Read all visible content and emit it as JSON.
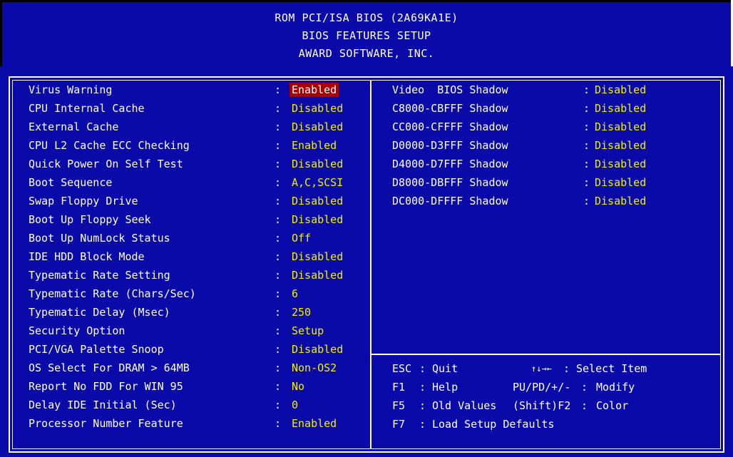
{
  "header": {
    "line1": "ROM PCI/ISA BIOS (2A69KA1E)",
    "line2": "BIOS FEATURES SETUP",
    "line3": "AWARD SOFTWARE, INC."
  },
  "colors": {
    "background": "#0a0aa8",
    "value": "#f0f000",
    "selected_bg": "#a80000",
    "text": "#ffffff"
  },
  "left_settings": [
    {
      "label": "Virus Warning",
      "colon": ":",
      "value": "Enabled",
      "selected": true
    },
    {
      "label": "CPU Internal Cache",
      "colon": ":",
      "value": "Disabled"
    },
    {
      "label": "External Cache",
      "colon": ":",
      "value": "Disabled"
    },
    {
      "label": "CPU L2 Cache ECC Checking",
      "colon": ":",
      "value": "Enabled"
    },
    {
      "label": "Quick Power On Self Test",
      "colon": ":",
      "value": "Disabled"
    },
    {
      "label": "Boot Sequence",
      "colon": ":",
      "value": "A,C,SCSI"
    },
    {
      "label": "Swap Floppy Drive",
      "colon": ":",
      "value": "Disabled"
    },
    {
      "label": "Boot Up Floppy Seek",
      "colon": ":",
      "value": "Disabled"
    },
    {
      "label": "Boot Up NumLock Status",
      "colon": ":",
      "value": "Off"
    },
    {
      "label": "IDE HDD Block Mode",
      "colon": ":",
      "value": "Disabled"
    },
    {
      "label": "Typematic Rate Setting",
      "colon": ":",
      "value": "Disabled"
    },
    {
      "label": "Typematic Rate (Chars/Sec)",
      "colon": ":",
      "value": "6"
    },
    {
      "label": "Typematic Delay (Msec)",
      "colon": ":",
      "value": "250"
    },
    {
      "label": "Security Option",
      "colon": ":",
      "value": "Setup"
    },
    {
      "label": "PCI/VGA Palette Snoop",
      "colon": ":",
      "value": "Disabled"
    },
    {
      "label": "OS Select For DRAM > 64MB",
      "colon": ":",
      "value": "Non-OS2"
    },
    {
      "label": "Report No FDD For WIN 95",
      "colon": ":",
      "value": "No"
    },
    {
      "label": "Delay IDE Initial (Sec)",
      "colon": ":",
      "value": "0"
    },
    {
      "label": "Processor Number Feature",
      "colon": ":",
      "value": "Enabled"
    }
  ],
  "right_settings": [
    {
      "label": "Video  BIOS Shadow",
      "colon": ":",
      "value": "Disabled"
    },
    {
      "label": "C8000-CBFFF Shadow",
      "colon": ":",
      "value": "Disabled"
    },
    {
      "label": "CC000-CFFFF Shadow",
      "colon": ":",
      "value": "Disabled"
    },
    {
      "label": "D0000-D3FFF Shadow",
      "colon": ":",
      "value": "Disabled"
    },
    {
      "label": "D4000-D7FFF Shadow",
      "colon": ":",
      "value": "Disabled"
    },
    {
      "label": "D8000-DBFFF Shadow",
      "colon": ":",
      "value": "Disabled"
    },
    {
      "label": "DC000-DFFFF Shadow",
      "colon": ":",
      "value": "Disabled"
    }
  ],
  "help": [
    {
      "key": "ESC",
      "sep": ":",
      "desc": "Quit",
      "key2": "↑↓→←",
      "sep2": ":",
      "desc2": "Select Item"
    },
    {
      "key": "F1",
      "sep": ":",
      "desc": "Help",
      "key2": "PU/PD/+/-",
      "sep2": ":",
      "desc2": "Modify"
    },
    {
      "key": "F5",
      "sep": ":",
      "desc": "Old Values",
      "key2": "(Shift)F2",
      "sep2": ":",
      "desc2": "Color"
    },
    {
      "key": "F7",
      "sep": ":",
      "desc": "Load Setup Defaults"
    }
  ]
}
